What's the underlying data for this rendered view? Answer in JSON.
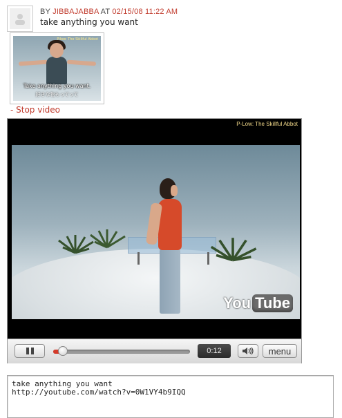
{
  "post": {
    "by_label": "BY",
    "author": "JIBBAJABBA",
    "at_label": "AT",
    "timestamp": "02/15/08 11:22 AM",
    "text": "take anything you want"
  },
  "thumbnail": {
    "tag": "Pilow: The Skillful Abbot",
    "caption": "Take anything you want.",
    "caption_jp": "好きな物もってって"
  },
  "stop_video_label": "- Stop video",
  "player": {
    "title": "P-Low: The Skillful Abbot",
    "logo_you": "You",
    "logo_tube": "Tube",
    "time": "0:12",
    "progress_fraction": 0.07,
    "menu_label": "menu",
    "icons": {
      "pause": "pause-icon",
      "volume": "speaker-icon"
    }
  },
  "embed": {
    "value": "take anything you want\nhttp://youtube.com/watch?v=0W1VY4b9IQQ"
  },
  "colors": {
    "accent": "#c0392b",
    "progress": "#d43a2a"
  }
}
